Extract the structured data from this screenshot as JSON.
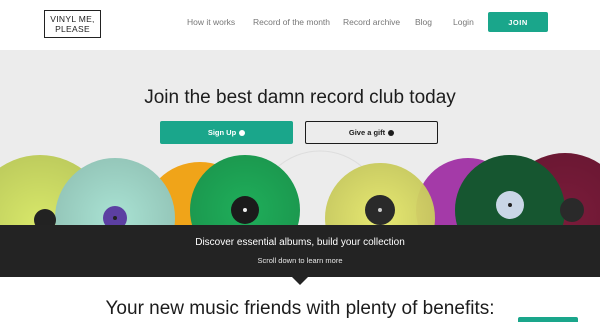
{
  "header": {
    "logo_line1": "VINYL ME,",
    "logo_line2": "PLEASE",
    "nav": [
      {
        "label": "How it works"
      },
      {
        "label": "Record of the month"
      },
      {
        "label": "Record archive"
      },
      {
        "label": "Blog"
      },
      {
        "label": "Login"
      }
    ],
    "join_label": "JOIN"
  },
  "hero": {
    "title": "Join the best damn record club today",
    "signup_label": "Sign Up",
    "gift_label": "Give a gift",
    "signup_icon": "arrow-circle-icon",
    "gift_icon": "arrow-circle-icon"
  },
  "band": {
    "title": "Discover essential albums, build your collection",
    "subtitle": "Scroll down to learn more"
  },
  "benefits": {
    "title": "Your new music friends with plenty of benefits:"
  },
  "colors": {
    "accent": "#1aa68b",
    "dark": "#232323"
  }
}
